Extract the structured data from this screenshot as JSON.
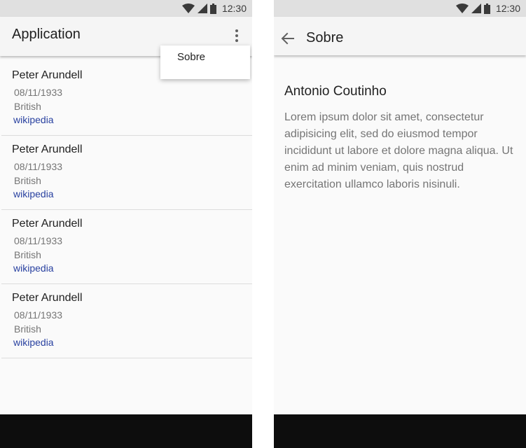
{
  "status_bar": {
    "time": "12:30"
  },
  "main_screen": {
    "title": "Application",
    "menu": {
      "items": [
        {
          "label": "Sobre"
        }
      ]
    },
    "list": [
      {
        "name": "Peter Arundell",
        "date": "08/11/1933",
        "nationality": "British",
        "link": "wikipedia"
      },
      {
        "name": "Peter Arundell",
        "date": "08/11/1933",
        "nationality": "British",
        "link": "wikipedia"
      },
      {
        "name": "Peter Arundell",
        "date": "08/11/1933",
        "nationality": "British",
        "link": "wikipedia"
      },
      {
        "name": "Peter Arundell",
        "date": "08/11/1933",
        "nationality": "British",
        "link": "wikipedia"
      }
    ]
  },
  "about_screen": {
    "title": "Sobre",
    "heading": "Antonio Coutinho",
    "body": "Lorem ipsum dolor sit amet, consectetur adipisicing elit, sed do eiusmod tempor incididunt ut labore et dolore magna aliqua. Ut enim ad minim veniam, quis nostrud exercitation ullamco laboris nisinuli."
  },
  "icons": {
    "wifi": "wifi-icon",
    "signal": "cell-signal-icon",
    "battery": "battery-icon",
    "overflow": "more-vert-icon",
    "back": "arrow-back-icon"
  },
  "colors": {
    "link": "#2941a0",
    "status_bar": "#e0e0e0",
    "app_bar": "#f5f5f5",
    "nav_bar": "#0d0d0d"
  }
}
